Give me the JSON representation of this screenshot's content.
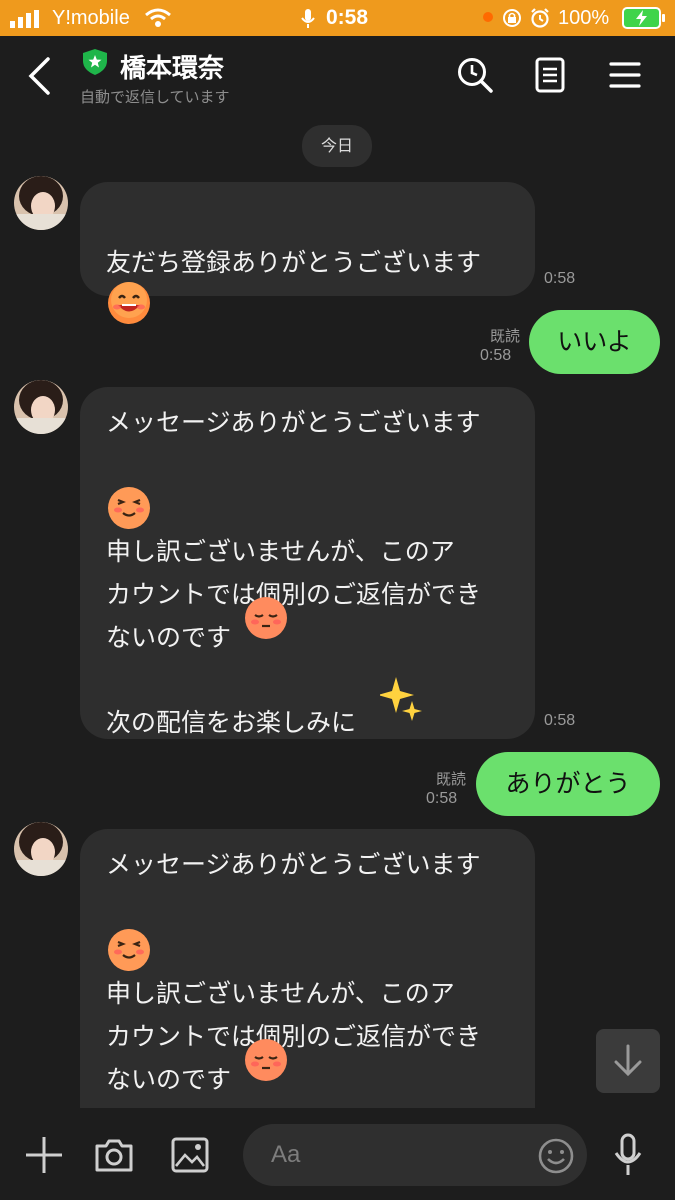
{
  "status_bar": {
    "carrier": "Y!mobile",
    "time": "0:58",
    "battery": "100%"
  },
  "header": {
    "title": "橋本環奈",
    "subtitle": "自動で返信しています"
  },
  "chat": {
    "date_label": "今日",
    "messages": [
      {
        "from": "official",
        "text": "友だち登録ありがとうございます",
        "time": "0:58"
      },
      {
        "from": "me",
        "text": "いいよ",
        "read": "既読",
        "time": "0:58"
      },
      {
        "from": "official",
        "line1": "メッセージありがとうございます",
        "line2": "申し訳ございませんが、このア",
        "line3": "カウントでは個別のご返信ができ",
        "line4": "ないのです",
        "line5": "次の配信をお楽しみに",
        "time": "0:58"
      },
      {
        "from": "me",
        "text": "ありがとう",
        "read": "既読",
        "time": "0:58"
      },
      {
        "from": "official",
        "line1": "メッセージありがとうございます",
        "line2": "申し訳ございませんが、このア",
        "line3": "カウントでは個別のご返信ができ",
        "line4": "ないのです"
      }
    ]
  },
  "composer": {
    "placeholder": "Aa"
  },
  "colors": {
    "status_bar": "#ef9a1d",
    "background": "#1d1d1d",
    "incoming_bubble": "#2e2e2e",
    "outgoing_bubble": "#6be06d",
    "official_badge": "#1fb54a"
  }
}
